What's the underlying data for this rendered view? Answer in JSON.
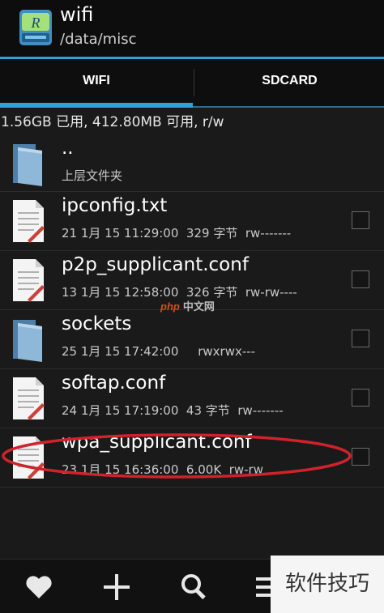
{
  "header": {
    "title": "wifi",
    "path": "/data/misc"
  },
  "tabs": [
    {
      "label": "WIFI",
      "active": true
    },
    {
      "label": "SDCARD",
      "active": false
    }
  ],
  "storage_info": "1.56GB 已用, 412.80MB 可用, r/w",
  "files": [
    {
      "name": "..",
      "meta": "上层文件夹",
      "type": "folder",
      "checkbox": false
    },
    {
      "name": "ipconfig.txt",
      "meta": "21 1月 15 11:29:00  329 字节  rw-------",
      "type": "file",
      "checkbox": true
    },
    {
      "name": "p2p_supplicant.conf",
      "meta": "13 1月 15 12:58:00  326 字节  rw-rw----",
      "type": "file",
      "checkbox": true
    },
    {
      "name": "sockets",
      "meta": "25 1月 15 17:42:00     rwxrwx---",
      "type": "folder",
      "checkbox": true
    },
    {
      "name": "softap.conf",
      "meta": "24 1月 15 17:19:00  43 字节  rw-------",
      "type": "file",
      "checkbox": true
    },
    {
      "name": "wpa_supplicant.conf",
      "meta": "23 1月 15 16:36:00  6.00K  rw-rw",
      "type": "file",
      "checkbox": true
    }
  ],
  "highlight_color": "#d0222a",
  "accent_color": "#2fa3d4",
  "bottom_bar": {
    "icons": [
      "heart-icon",
      "plus-icon",
      "search-icon",
      "menu-icon"
    ]
  },
  "watermarks": {
    "center_logo": "php",
    "center_text": "中文网",
    "corner_text": "软件技巧"
  }
}
